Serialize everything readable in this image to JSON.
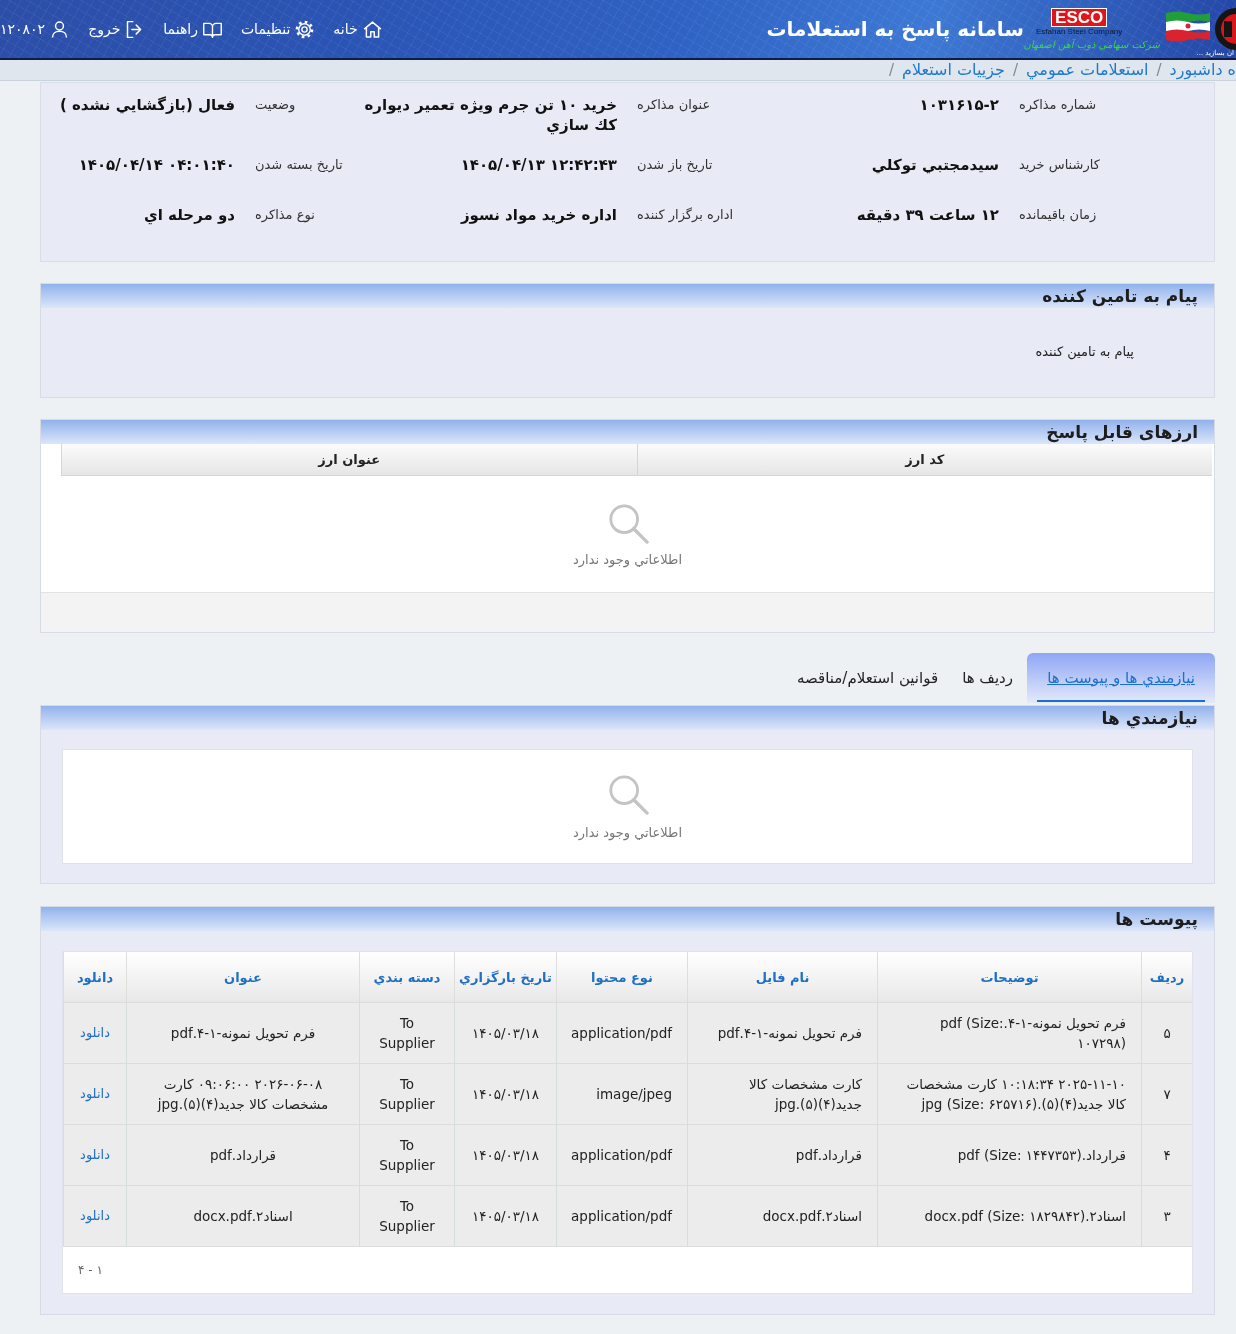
{
  "header": {
    "logo": {
      "brand": "ESCO",
      "brand_subtitle": "Esfahan Steel Company",
      "company": "شركت سهامي ذوب آهن اصفهان",
      "slogan": "ان بسازيد ..."
    },
    "title": "سامانه پاسخ به استعلامات",
    "nav": [
      {
        "kind": "home",
        "label": "خانه"
      },
      {
        "kind": "settings",
        "label": "تنظيمات"
      },
      {
        "kind": "guide",
        "label": "راهنما"
      },
      {
        "kind": "logout",
        "label": "خروج"
      },
      {
        "kind": "user",
        "label": "۱۲۰۸۰۲"
      }
    ]
  },
  "breadcrumb": [
    {
      "label": "ه داشبورد",
      "separator": "/"
    },
    {
      "label": "استعلامات عمومي",
      "separator": "/"
    },
    {
      "label": "جزييات استعلام",
      "separator": "/"
    }
  ],
  "summary": {
    "fields": [
      {
        "label": "شماره مذاكره",
        "value": "۱۰۳۱۶۱۵-۲"
      },
      {
        "label": "عنوان مذاكره",
        "value": "خريد ۱۰ تن جرم ويژه تعمير ديواره كك سازي"
      },
      {
        "label": "وضعيت",
        "value": "فعال (بازگشايي نشده )"
      },
      {
        "label": "كارشناس خريد",
        "value": "سيدمجتبي توكلي"
      },
      {
        "label": "تاريخ باز شدن",
        "value": "۱۴۰۵/۰۴/۱۳ ۱۲:۴۲:۴۳"
      },
      {
        "label": "تاريخ بسته شدن",
        "value": "۱۴۰۵/۰۴/۱۴ ۰۴:۰۱:۴۰"
      },
      {
        "label": "زمان باقيمانده",
        "value": "۱۲ ساعت ۳۹ دقيقه"
      },
      {
        "label": "اداره برگزار كننده",
        "value": "اداره خريد مواد نسوز"
      },
      {
        "label": "نوع مذاكره",
        "value": "دو مرحله اي"
      }
    ]
  },
  "supplier_message": {
    "title": "پيام به تامين كننده",
    "text": "پيام به تامين كننده"
  },
  "currencies": {
    "title": "ارزهای قابل پاسخ",
    "columns": [
      "كد ارز",
      "عنوان ارز"
    ],
    "empty_text": "اطلاعاتي وجود ندارد"
  },
  "tabs": [
    {
      "label": "نيازمندي ها و پيوست ها",
      "selected": true
    },
    {
      "label": "رديف ها",
      "selected": false
    },
    {
      "label": "قوانين استعلام/مناقصه",
      "selected": false
    }
  ],
  "requirements": {
    "title": "نيازمندي ها",
    "empty_text": "اطلاعاتي وجود ندارد"
  },
  "attachments": {
    "title": "پيوست ها",
    "columns": [
      "رديف",
      "توضيحات",
      "نام فايل",
      "نوع محتوا",
      "تاريخ بارگزاري",
      "دسته بندي",
      "عنوان",
      "دانلود"
    ],
    "rows": [
      {
        "row": "۵",
        "description": "فرم تحويل نمونه-۱-۴.pdf (Size: ۱۰۷۲۹۸)",
        "file_name": "فرم تحويل نمونه-۱-۴.pdf",
        "content_type": "application/pdf",
        "upload_date": "۱۴۰۵/۰۳/۱۸",
        "category": "To Supplier",
        "title": "فرم تحويل نمونه-۱-۴.pdf",
        "download": "دانلود"
      },
      {
        "row": "۷",
        "description": "۲۰۲۵-۱۱-۱۰ ۱۰:۱۸:۳۴ كارت مشخصات كالا جديد(۴)(۵).jpg (Size: ۶۲۵۷۱۶)",
        "file_name": "كارت مشخصات كالا جديد(۴)(۵).jpg",
        "content_type": "image/jpeg",
        "upload_date": "۱۴۰۵/۰۳/۱۸",
        "category": "To Supplier",
        "title": "۲۰۲۶-۰۶-۰۸ ۰۹:۰۶:۰۰ كارت مشخصات كالا جديد(۴)(۵).jpg",
        "download": "دانلود"
      },
      {
        "row": "۴",
        "description": "قرارداد.pdf (Size: ۱۴۴۷۳۵۳)",
        "file_name": "قرارداد.pdf",
        "content_type": "application/pdf",
        "upload_date": "۱۴۰۵/۰۳/۱۸",
        "category": "To Supplier",
        "title": "قرارداد.pdf",
        "download": "دانلود"
      },
      {
        "row": "۳",
        "description": "اسناد۲.docx.pdf (Size: ۱۸۲۹۸۴۲)",
        "file_name": "اسناد۲.docx.pdf",
        "content_type": "application/pdf",
        "upload_date": "۱۴۰۵/۰۳/۱۸",
        "category": "To Supplier",
        "title": "اسناد۲.docx.pdf",
        "download": "دانلود"
      }
    ],
    "pagination": "۱ - ۴"
  }
}
